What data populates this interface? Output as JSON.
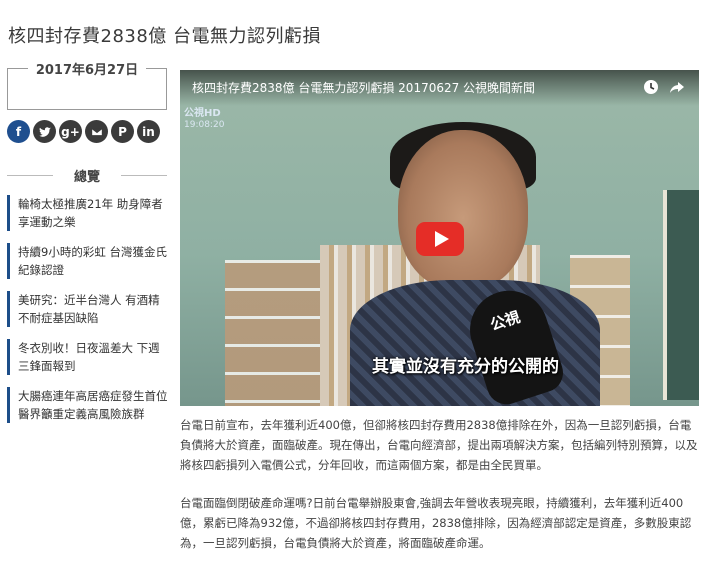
{
  "page": {
    "title": "核四封存費2838億 台電無力認列虧損"
  },
  "sidebar": {
    "date": "2017年6月27日",
    "share_icons": [
      "facebook-icon",
      "twitter-icon",
      "google-plus-icon",
      "mail-icon",
      "pinterest-icon",
      "linkedin-icon"
    ],
    "overview_heading": "總覽",
    "news_items": [
      {
        "label": "輪椅太極推廣21年 助身障者享運動之樂"
      },
      {
        "label": "持續9小時的彩虹 台灣獲金氏紀錄認證"
      },
      {
        "label": "美研究：近半台灣人 有酒精不耐症基因缺陷"
      },
      {
        "label": "冬衣別收！日夜溫差大 下週三鋒面報到"
      },
      {
        "label": "大腸癌連年高居癌症發生首位 醫界籲重定義高風險族群"
      }
    ]
  },
  "video": {
    "title": "核四封存費2838億 台電無力認列虧損 20170627 公視晚間新聞",
    "channel_logo": "公視HD",
    "timestamp": "19:08:20",
    "subtitle": "其實並沒有充分的公開的",
    "mic_logo": "公視",
    "play_color": "#e52d27"
  },
  "article": {
    "paragraphs": [
      "台電日前宣布，去年獲利近400億，但卻將核四封存費用2838億排除在外，因為一旦認列虧損，台電負債將大於資產，面臨破產。現在傳出，台電向經濟部，提出兩項解決方案，包括編列特別預算，以及將核四虧損列入電價公式，分年回收，而這兩個方案，都是由全民買單。",
      "台電面臨倒閉破產命運嗎?日前台電舉辦股東會,強調去年營收表現亮眼，持續獲利，去年獲利近400億，累虧已降為932億，不過卻將核四封存費用，2838億排除，因為經濟部認定是資產，多數股東認為，一旦認列虧損，台電負債將大於資產，將面臨破產命運。"
    ]
  }
}
